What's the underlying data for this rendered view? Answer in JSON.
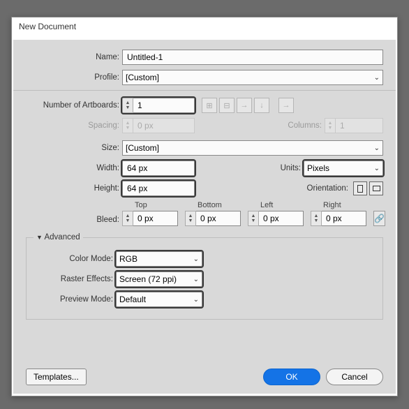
{
  "dialog": {
    "title": "New Document"
  },
  "labels": {
    "name": "Name:",
    "profile": "Profile:",
    "artboards": "Number of Artboards:",
    "spacing": "Spacing:",
    "columns": "Columns:",
    "size": "Size:",
    "width": "Width:",
    "height": "Height:",
    "units": "Units:",
    "orientation": "Orientation:",
    "bleed": "Bleed:",
    "top": "Top",
    "bottom": "Bottom",
    "left": "Left",
    "right": "Right",
    "advanced": "Advanced",
    "colorMode": "Color Mode:",
    "rasterEffects": "Raster Effects:",
    "previewMode": "Preview Mode:"
  },
  "values": {
    "name": "Untitled-1",
    "profile": "[Custom]",
    "artboards": "1",
    "spacing": "0 px",
    "columns": "1",
    "size": "[Custom]",
    "width": "64 px",
    "height": "64 px",
    "units": "Pixels",
    "bleedTop": "0 px",
    "bleedBottom": "0 px",
    "bleedLeft": "0 px",
    "bleedRight": "0 px",
    "colorMode": "RGB",
    "rasterEffects": "Screen (72 ppi)",
    "previewMode": "Default"
  },
  "buttons": {
    "templates": "Templates...",
    "ok": "OK",
    "cancel": "Cancel"
  },
  "icons": {
    "grid1": "⊞",
    "grid2": "⊟",
    "arrowR": "→",
    "arrowL": "←",
    "arrowD": "↓",
    "arrowOut": "→",
    "link": "🔗"
  }
}
